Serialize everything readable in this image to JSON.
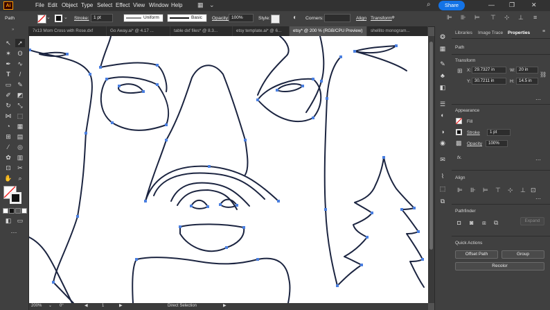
{
  "app": {
    "logo": "Ai"
  },
  "menu": [
    "File",
    "Edit",
    "Object",
    "Type",
    "Select",
    "Effect",
    "View",
    "Window",
    "Help"
  ],
  "share_label": "Share",
  "control": {
    "selection": "Path",
    "stroke_label": "Stroke:",
    "stroke_value": "1 pt",
    "profile": "Uniform",
    "brush": "Basic",
    "opacity_label": "Opacity:",
    "opacity_value": "100%",
    "style_label": "Style:",
    "corners_label": "Corners:",
    "align_label": "Align",
    "transform_label": "Transform"
  },
  "tabs": [
    {
      "label": "7x13 Mom Cross with Rose.dxf"
    },
    {
      "label": "Go Away.ai* @ 4.17 ..."
    },
    {
      "label": "table dxf files* @ 8.3..."
    },
    {
      "label": "etsy template.ai* @ 6..."
    },
    {
      "label": "etsy* @ 200 % (RGB/CPU Preview)"
    },
    {
      "label": "shellito monogram..."
    }
  ],
  "status": {
    "zoom": "200%",
    "rotation": "0°",
    "artboard": "1",
    "tool": "Direct Selection"
  },
  "panel": {
    "tabs": [
      "Libraries",
      "Image Trace",
      "Properties"
    ],
    "active_tab": "Properties",
    "selection": "Path",
    "transform": {
      "title": "Transform",
      "x_label": "X:",
      "x": "29.7327 in",
      "y_label": "Y:",
      "y": "30.7211 in",
      "w_label": "W:",
      "w": "20 in",
      "h_label": "H:",
      "h": "14.5 in"
    },
    "appearance": {
      "title": "Appearance",
      "fill": "Fill",
      "stroke": "Stroke",
      "stroke_value": "1 pt",
      "opacity": "Opacity",
      "opacity_value": "100%",
      "fx": "fx."
    },
    "align_title": "Align",
    "pathfinder": {
      "title": "Pathfinder",
      "expand": "Expand"
    },
    "quick_actions": {
      "title": "Quick Actions",
      "offset_path": "Offset Path",
      "group": "Group",
      "recolor": "Recolor"
    }
  },
  "colors": {
    "accent": "#1473e6",
    "path": "#1b2440",
    "anchor": "#4a7fe0",
    "canvas": "#ffffff"
  }
}
